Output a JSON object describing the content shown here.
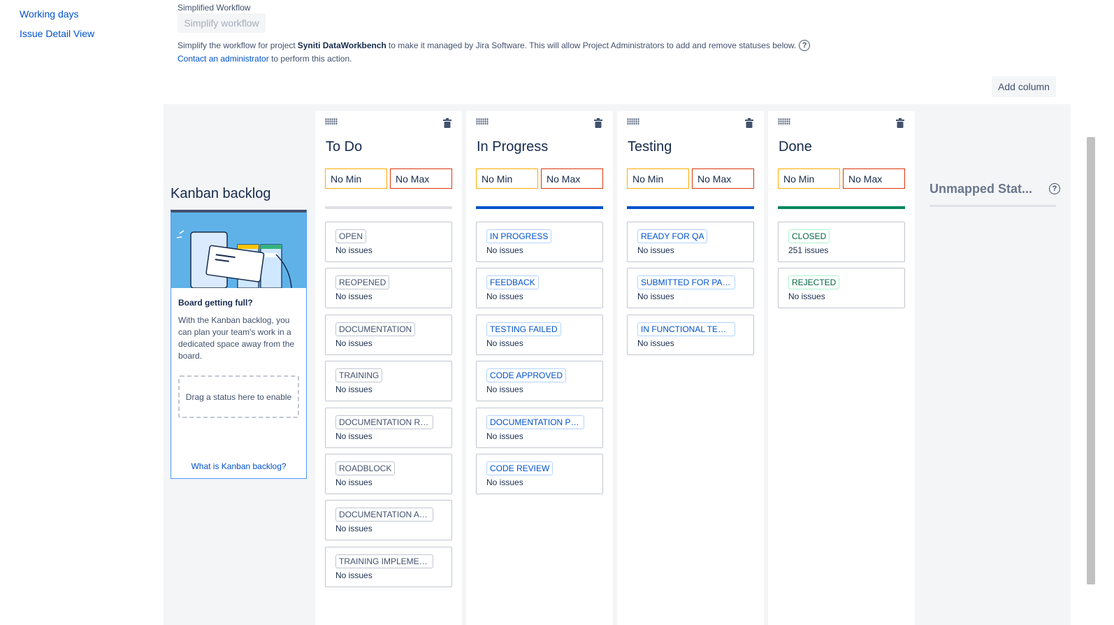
{
  "sidebar": {
    "items": [
      "Working days",
      "Issue Detail View"
    ]
  },
  "workflow": {
    "title": "Simplified Workflow",
    "button": "Simplify workflow",
    "desc_prefix": "Simplify the workflow for project",
    "project": "Syniti DataWorkbench",
    "desc_suffix": "to make it managed by Jira Software. This will allow Project Administrators to add and remove statuses below.",
    "contact_link": "Contact an administrator",
    "contact_suffix": "to perform this action."
  },
  "add_column": "Add column",
  "backlog": {
    "title": "Kanban backlog",
    "heading": "Board getting full?",
    "text": "With the Kanban backlog, you can plan your team's work in a dedicated space away from the board.",
    "dropzone": "Drag a status here to enable",
    "link": "What is Kanban backlog?"
  },
  "colors": {
    "todo": "#dfe1e6",
    "inprogress": "#0052cc",
    "testing": "#0052cc",
    "done": "#00875a"
  },
  "columns": [
    {
      "title": "To Do",
      "min": "No Min",
      "max": "No Max",
      "cards": [
        {
          "status": "OPEN",
          "count": "No issues"
        },
        {
          "status": "REOPENED",
          "count": "No issues"
        },
        {
          "status": "DOCUMENTATION",
          "count": "No issues"
        },
        {
          "status": "TRAINING",
          "count": "No issues"
        },
        {
          "status": "DOCUMENTATION RE...",
          "count": "No issues"
        },
        {
          "status": "ROADBLOCK",
          "count": "No issues"
        },
        {
          "status": "DOCUMENTATION AP...",
          "count": "No issues"
        },
        {
          "status": "TRAINING IMPLEMEN...",
          "count": "No issues"
        }
      ]
    },
    {
      "title": "In Progress",
      "min": "No Min",
      "max": "No Max",
      "cards": [
        {
          "status": "IN PROGRESS",
          "count": "No issues"
        },
        {
          "status": "FEEDBACK",
          "count": "No issues"
        },
        {
          "status": "TESTING FAILED",
          "count": "No issues"
        },
        {
          "status": "CODE APPROVED",
          "count": "No issues"
        },
        {
          "status": "DOCUMENTATION PEE...",
          "count": "No issues"
        },
        {
          "status": "CODE REVIEW",
          "count": "No issues"
        }
      ]
    },
    {
      "title": "Testing",
      "min": "No Min",
      "max": "No Max",
      "cards": [
        {
          "status": "READY FOR QA",
          "count": "No issues"
        },
        {
          "status": "SUBMITTED FOR PART...",
          "count": "No issues"
        },
        {
          "status": "IN FUNCTIONAL TESTI...",
          "count": "No issues"
        }
      ]
    },
    {
      "title": "Done",
      "min": "No Min",
      "max": "No Max",
      "cards": [
        {
          "status": "CLOSED",
          "count": "251 issues"
        },
        {
          "status": "REJECTED",
          "count": "No issues"
        }
      ]
    }
  ],
  "unmapped": {
    "title": "Unmapped Stat..."
  }
}
